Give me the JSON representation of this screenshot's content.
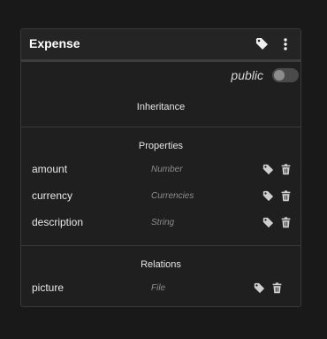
{
  "card": {
    "title": "Expense",
    "public_label": "public",
    "public_enabled": false
  },
  "icons": {
    "header_tag": "tag-icon",
    "header_menu": "more-vertical-icon",
    "row_tag": "tag-icon",
    "row_delete": "trash-icon"
  },
  "colors": {
    "background": "#191919",
    "card": "#1f1f1f",
    "icon": "#cfcfcf",
    "type_text": "#8c8c8c"
  },
  "sections": {
    "inheritance": {
      "title": "Inheritance"
    },
    "properties": {
      "title": "Properties",
      "fields": [
        {
          "name": "amount",
          "type": "Number"
        },
        {
          "name": "currency",
          "type": "Currencies"
        },
        {
          "name": "description",
          "type": "String"
        }
      ]
    },
    "relations": {
      "title": "Relations",
      "fields": [
        {
          "name": "picture",
          "type": "File"
        }
      ]
    }
  }
}
